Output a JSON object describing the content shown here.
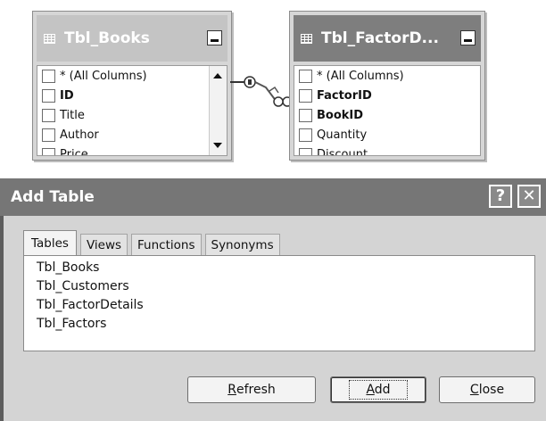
{
  "diagram": {
    "books_table": {
      "title": "Tbl_Books",
      "columns": [
        "* (All Columns)",
        "ID",
        "Title",
        "Author",
        "Price"
      ]
    },
    "factor_table": {
      "title": "Tbl_FactorD...",
      "columns": [
        "* (All Columns)",
        "FactorID",
        "BookID",
        "Quantity",
        "Discount"
      ]
    }
  },
  "dialog": {
    "title": "Add Table",
    "title_buttons": {
      "help": "?",
      "close": "✕"
    },
    "tabs": [
      "Tables",
      "Views",
      "Functions",
      "Synonyms"
    ],
    "active_tab": "Tables",
    "table_list": [
      "Tbl_Books",
      "Tbl_Customers",
      "Tbl_FactorDetails",
      "Tbl_Factors"
    ],
    "buttons": {
      "refresh_mnemonic": "R",
      "refresh_rest": "efresh",
      "add_mnemonic": "A",
      "add_rest": "dd",
      "close_mnemonic": "C",
      "close_rest": "lose"
    }
  },
  "colors": {
    "active_title": "#7e7e7e",
    "inactive_title": "#c4c4c4",
    "dialog_face": "#d4d4d4"
  }
}
